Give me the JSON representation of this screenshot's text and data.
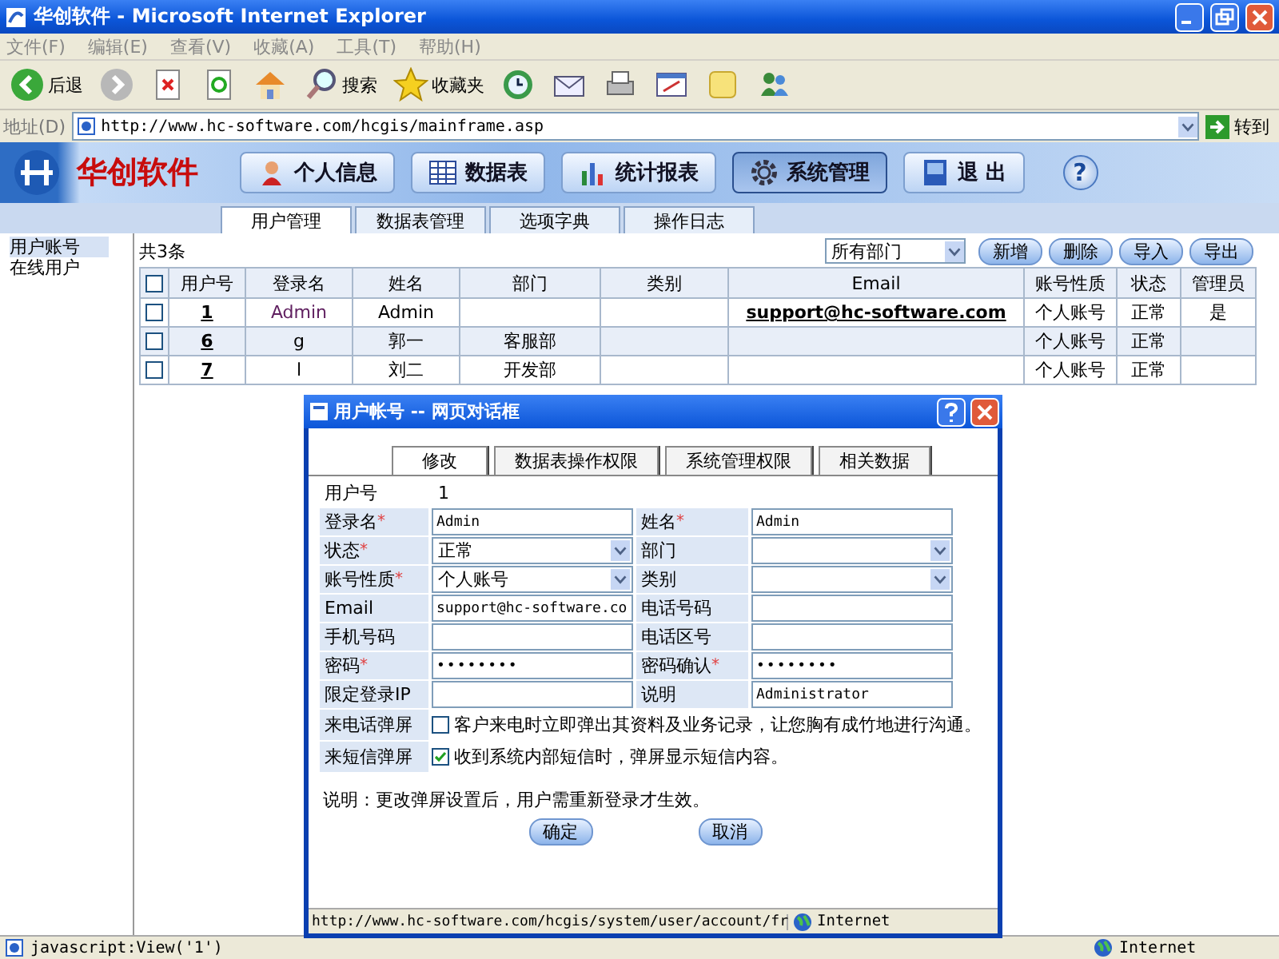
{
  "window": {
    "title": "华创软件 - Microsoft Internet Explorer"
  },
  "menu": [
    "文件(F)",
    "编辑(E)",
    "查看(V)",
    "收藏(A)",
    "工具(T)",
    "帮助(H)"
  ],
  "toolbar": [
    {
      "kind": "back",
      "label": "后退"
    },
    {
      "kind": "forward"
    },
    {
      "kind": "stop"
    },
    {
      "kind": "refresh"
    },
    {
      "kind": "home"
    },
    {
      "kind": "search",
      "label": "搜索"
    },
    {
      "kind": "favorites",
      "label": "收藏夹"
    },
    {
      "kind": "history"
    },
    {
      "kind": "mail"
    },
    {
      "kind": "print"
    },
    {
      "kind": "edit"
    },
    {
      "kind": "notes"
    },
    {
      "kind": "messenger"
    }
  ],
  "address": {
    "label": "地址(D)",
    "url": "http://www.hc-software.com/hcgis/mainframe.asp",
    "go": "转到"
  },
  "app": {
    "logo": "华创软件",
    "help": "?",
    "nav": [
      {
        "label": "个人信息",
        "kind": "person",
        "selected": false
      },
      {
        "label": "数据表",
        "kind": "table",
        "selected": false
      },
      {
        "label": "统计报表",
        "kind": "chart",
        "selected": false
      },
      {
        "label": "系统管理",
        "kind": "gear",
        "selected": true
      },
      {
        "label": "退 出",
        "kind": "door",
        "selected": false
      }
    ]
  },
  "tabs": [
    {
      "label": "用户管理",
      "selected": true
    },
    {
      "label": "数据表管理",
      "selected": false
    },
    {
      "label": "选项字典",
      "selected": false
    },
    {
      "label": "操作日志",
      "selected": false
    }
  ],
  "sidebar": [
    {
      "label": "用户账号",
      "selected": true
    },
    {
      "label": "在线用户",
      "selected": false
    }
  ],
  "list": {
    "count": "共3条",
    "select_all": {
      "checked": false
    },
    "filter": "所有部门",
    "actions": [
      "新增",
      "删除",
      "导入",
      "导出"
    ],
    "columns": [
      "用户号",
      "登录名",
      "姓名",
      "部门",
      "类别",
      "Email",
      "账号性质",
      "状态",
      "管理员"
    ],
    "rows": [
      {
        "checked": false,
        "id": "1",
        "login": "Admin",
        "name": "Admin",
        "email": "support@hc-software.com",
        "type": "个人账号",
        "status": "正常",
        "admin": "是"
      },
      {
        "checked": false,
        "id": "6",
        "login": "g",
        "name": "郭一",
        "dept": "客服部",
        "type": "个人账号",
        "status": "正常"
      },
      {
        "checked": false,
        "id": "7",
        "login": "l",
        "name": "刘二",
        "dept": "开发部",
        "type": "个人账号",
        "status": "正常"
      }
    ]
  },
  "dialog": {
    "title": "用户帐号 -- 网页对话框",
    "tabs": [
      {
        "label": "修改",
        "selected": true
      },
      {
        "label": "数据表操作权限",
        "selected": false
      },
      {
        "label": "系统管理权限",
        "selected": false
      },
      {
        "label": "相关数据",
        "selected": false
      }
    ],
    "required_mark": "*",
    "id_label": "用户号",
    "id_value": "1",
    "fields": [
      {
        "label": "登录名",
        "required": true,
        "kind": "input",
        "value": "Admin"
      },
      {
        "label": "姓名",
        "required": true,
        "kind": "input",
        "value": "Admin"
      },
      {
        "label": "状态",
        "required": true,
        "kind": "select",
        "value": "正常"
      },
      {
        "label": "部门",
        "required": false,
        "kind": "select"
      },
      {
        "label": "账号性质",
        "required": true,
        "kind": "select",
        "value": "个人账号"
      },
      {
        "label": "类别",
        "required": false,
        "kind": "select"
      },
      {
        "label": "Email",
        "required": false,
        "kind": "input",
        "value": "support@hc-software.co"
      },
      {
        "label": "电话号码",
        "required": false,
        "kind": "input"
      },
      {
        "label": "手机号码",
        "required": false,
        "kind": "input"
      },
      {
        "label": "电话区号",
        "required": false,
        "kind": "input"
      },
      {
        "label": "密码",
        "required": true,
        "kind": "password",
        "value": "••••••••"
      },
      {
        "label": "密码确认",
        "required": true,
        "kind": "password",
        "value": "••••••••"
      },
      {
        "label": "限定登录IP",
        "required": false,
        "kind": "input"
      },
      {
        "label": "说明",
        "required": false,
        "kind": "input",
        "value": "Administrator"
      }
    ],
    "popups": [
      {
        "label": "来电话弹屏",
        "checked": false,
        "text": "客户来电时立即弹出其资料及业务记录，让您胸有成竹地进行沟通。"
      },
      {
        "label": "来短信弹屏",
        "checked": true,
        "text": "收到系统内部短信时，弹屏显示短信内容。"
      }
    ],
    "note": "说明：更改弹屏设置后，用户需重新登录才生效。",
    "buttons": [
      "确定",
      "取消"
    ],
    "status_url": "http://www.hc-software.com/hcgis/system/user/account/fr",
    "zone": "Internet"
  },
  "status_bar": {
    "text": "javascript:View('1')",
    "zone": "Internet"
  }
}
